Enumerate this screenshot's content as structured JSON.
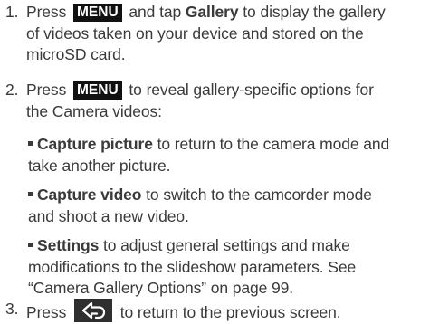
{
  "steps": [
    {
      "number": "1.",
      "press": "Press",
      "key": "MENU",
      "and_tap": "and tap",
      "gallery": "Gallery",
      "rest": "to display the gallery",
      "line2": "of videos taken on your device and stored on the",
      "line3": "microSD card."
    },
    {
      "number": "2.",
      "press": "Press",
      "key": "MENU",
      "rest": "to reveal gallery-specific options for",
      "line2": "the Camera videos:"
    },
    {
      "number": "3.",
      "press": "Press",
      "key_icon": "back-arrow-icon",
      "rest": "to return to the previous screen."
    }
  ],
  "bullets": [
    {
      "term": "Capture picture",
      "line1": "to return to the camera mode and",
      "line2": "take another picture."
    },
    {
      "term": "Capture video",
      "line1": "to switch to the camcorder mode",
      "line2": "and shoot a new video."
    },
    {
      "term": "Settings",
      "line1": "to adjust general settings and make",
      "line2": "modifications to the slideshow parameters. See",
      "line3": "“Camera Gallery Options” on page 99."
    }
  ]
}
